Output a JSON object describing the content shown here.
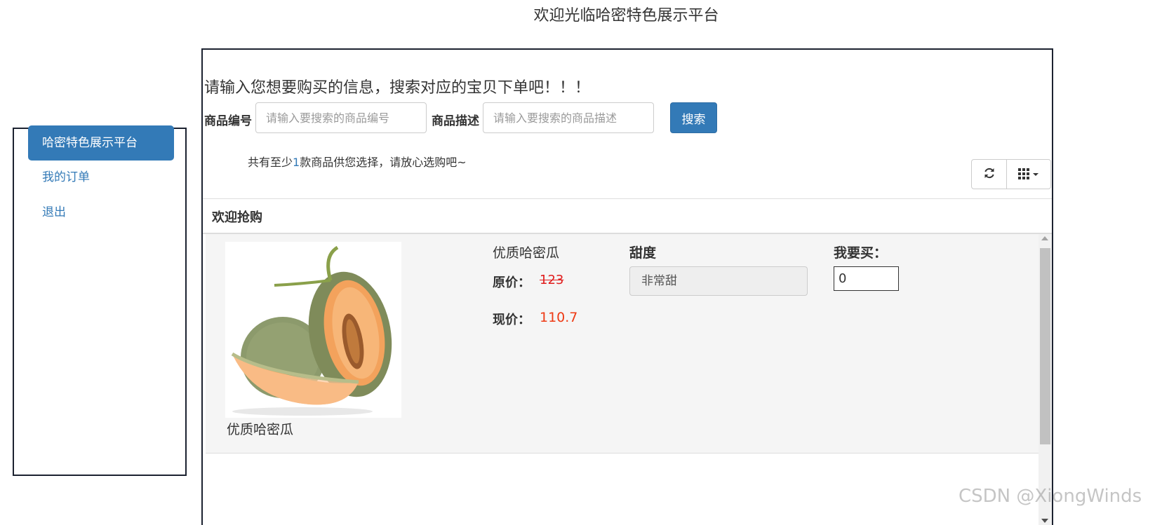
{
  "header": {
    "title": "欢迎光临哈密特色展示平台"
  },
  "sidebar": {
    "items": [
      {
        "label": "哈密特色展示平台",
        "active": true
      },
      {
        "label": "我的订单"
      },
      {
        "label": "退出"
      }
    ]
  },
  "main": {
    "prompt": "请输入您想要购买的信息，搜索对应的宝贝下单吧！！！",
    "search": {
      "code_label": "商品编号",
      "code_placeholder": "请输入要搜索的商品编号",
      "desc_label": "商品描述",
      "desc_placeholder": "请输入要搜索的商品描述",
      "button_label": "搜索"
    },
    "count_prefix": "共有至少",
    "count_value": "1",
    "count_suffix": "款商品供您选择，请放心选购吧~",
    "toolbar": {
      "refresh_icon": "refresh-icon",
      "columns_icon": "grid-icon"
    },
    "section_title": "欢迎抢购",
    "products": [
      {
        "name": "优质哈密瓜",
        "caption": "优质哈密瓜",
        "original_price_label": "原价：",
        "original_price": "123",
        "current_price_label": "现价：",
        "current_price": "110.7",
        "sweetness_label": "甜度",
        "sweetness": "非常甜",
        "buy_label": "我要买：",
        "quantity": "0"
      }
    ]
  },
  "watermark": "CSDN @XiongWinds",
  "colors": {
    "primary": "#337ab7",
    "price_red": "#ee3a14",
    "row_bg": "#f5f5f5"
  }
}
